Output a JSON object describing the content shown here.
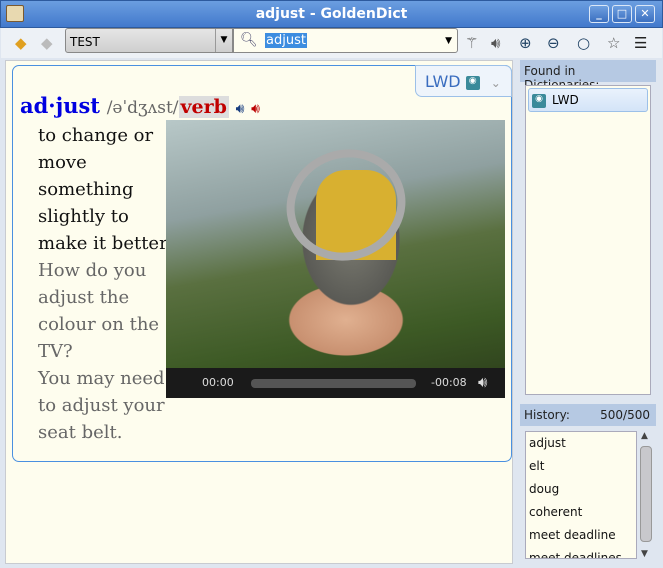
{
  "window": {
    "title": "adjust - GoldenDict",
    "min": "_",
    "max": "□",
    "close": "✕"
  },
  "toolbar": {
    "group": "TEST",
    "query": "adjust"
  },
  "article": {
    "dict_badge": "LWD",
    "headword": "ad·just",
    "pronunciation": "/əˈdʒʌst/",
    "pos": "verb",
    "definition": "to change or move something slightly to make it better",
    "examples": [
      "How do you adjust the colour on the TV?",
      "You may need to adjust your seat belt."
    ],
    "video": {
      "current_time": "00:00",
      "remaining_time": "-00:08",
      "progress": 0
    }
  },
  "dictionaries": {
    "header": "Found in Dictionaries:",
    "items": [
      {
        "name": "LWD"
      }
    ]
  },
  "history": {
    "header": "History:",
    "count": "500/500",
    "items": [
      "adjust",
      "elt",
      "doug",
      "coherent",
      "meet deadline",
      "meet deadlines"
    ]
  }
}
